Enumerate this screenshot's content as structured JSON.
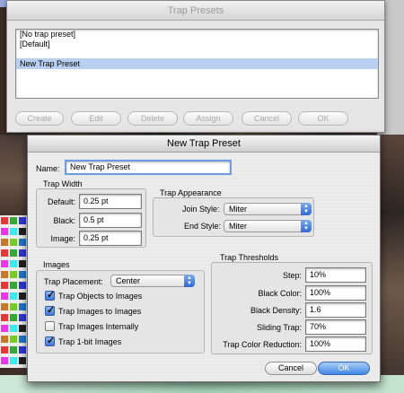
{
  "trap_presets": {
    "title": "Trap Presets",
    "list": [
      "[No trap preset]",
      "[Default]"
    ],
    "selected_item": "New Trap Preset",
    "buttons": {
      "create": "Create",
      "edit": "Edit",
      "delete": "Delete",
      "assign": "Assign",
      "cancel": "Cancel",
      "ok": "OK"
    }
  },
  "new_trap_preset": {
    "title": "New Trap Preset",
    "name_label": "Name:",
    "name_value": "New Trap Preset",
    "trap_width": {
      "heading": "Trap Width",
      "default_label": "Default:",
      "default_value": "0.25 pt",
      "black_label": "Black:",
      "black_value": "0.5 pt",
      "image_label": "Image:",
      "image_value": "0.25 pt"
    },
    "trap_appearance": {
      "heading": "Trap Appearance",
      "join_style_label": "Join Style:",
      "join_style_value": "Miter",
      "end_style_label": "End Style:",
      "end_style_value": "Miter"
    },
    "images": {
      "heading": "Images",
      "trap_placement_label": "Trap Placement:",
      "trap_placement_value": "Center",
      "options": [
        {
          "label": "Trap Objects to Images",
          "checked": true
        },
        {
          "label": "Trap Images to Images",
          "checked": true
        },
        {
          "label": "Trap Images Internally",
          "checked": false
        },
        {
          "label": "Trap 1-bit Images",
          "checked": true
        }
      ]
    },
    "trap_thresholds": {
      "heading": "Trap Thresholds",
      "step_label": "Step:",
      "step_value": "10%",
      "black_color_label": "Black Color:",
      "black_color_value": "100%",
      "black_density_label": "Black Density:",
      "black_density_value": "1.6",
      "sliding_trap_label": "Sliding Trap:",
      "sliding_trap_value": "70%",
      "trap_color_reduction_label": "Trap Color Reduction:",
      "trap_color_reduction_value": "100%"
    },
    "buttons": {
      "cancel": "Cancel",
      "ok": "OK"
    }
  },
  "colors": {
    "selection": "#b9cff0",
    "accent": "#3f86e6",
    "dialog_bg": "#e6e6e6"
  }
}
